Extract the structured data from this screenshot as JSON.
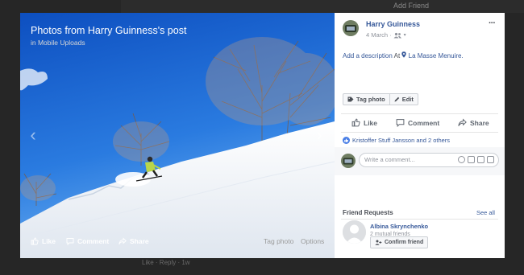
{
  "backdrop": {
    "add_friend": "Add Friend",
    "bottom_links": "Like · Reply · 1w"
  },
  "photo": {
    "title": "Photos from Harry Guinness's post",
    "album": "in Mobile Uploads",
    "actions": {
      "like": "Like",
      "comment": "Comment",
      "share": "Share",
      "tag_photo": "Tag photo",
      "options": "Options"
    }
  },
  "post": {
    "author": "Harry Guinness",
    "date": "4 March",
    "audience_icon": "friends-icon",
    "description_prompt": "Add a description",
    "at_word": "At",
    "location": "La Masse Menuire.",
    "tag_photo_button": "Tag photo",
    "edit_button": "Edit",
    "actions": {
      "like": "Like",
      "comment": "Comment",
      "share": "Share"
    },
    "reactions_text": "Kristoffer Stuff Jansson and 2 others",
    "comment_placeholder": "Write a comment..."
  },
  "friend_requests": {
    "title": "Friend Requests",
    "see_all": "See all",
    "name": "Albina Skrynchenko",
    "mutual": "2 mutual friends",
    "confirm": "Confirm friend"
  },
  "colors": {
    "link": "#365899",
    "sky": "#1f6fd6",
    "snow": "#f3f6fa"
  }
}
